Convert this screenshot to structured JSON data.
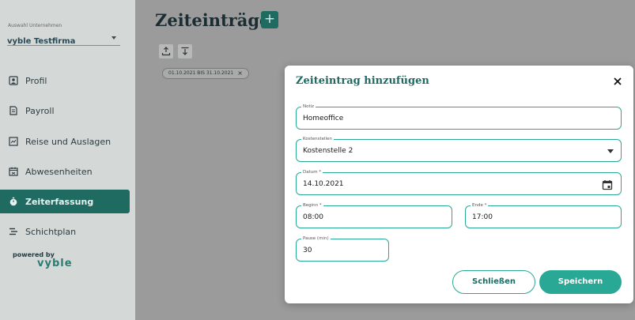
{
  "sidebar": {
    "company_caption": "Auswahl Unternehmen",
    "company_name": "vyble Testfirma",
    "items": [
      {
        "label": "Profil",
        "icon": "person-badge-icon"
      },
      {
        "label": "Payroll",
        "icon": "document-icon"
      },
      {
        "label": "Reise und Auslagen",
        "icon": "receipt-chart-icon"
      },
      {
        "label": "Abwesenheiten",
        "icon": "calendar-icon"
      },
      {
        "label": "Zeiterfassung",
        "icon": "stopwatch-icon",
        "active": true
      },
      {
        "label": "Schichtplan",
        "icon": "schedule-icon"
      }
    ],
    "powered_by": "powered by",
    "logo_text": "vyble"
  },
  "main": {
    "title": "Zeiteinträge",
    "add_label": "+",
    "filter_chip": "01.10.2021 BIS 31.10.2021",
    "chip_close": "×"
  },
  "modal": {
    "title": "Zeiteintrag hinzufügen",
    "close_label": "✕",
    "notiz": {
      "label": "Notiz",
      "value": "Homeoffice"
    },
    "kostenstellen": {
      "label": "Kostenstellen",
      "value": "Kostenstelle 2"
    },
    "datum": {
      "label": "Datum *",
      "value": "14.10.2021"
    },
    "beginn": {
      "label": "Beginn *",
      "value": "08:00"
    },
    "ende": {
      "label": "Ende *",
      "value": "17:00"
    },
    "pause": {
      "label": "Pause (min)",
      "value": "30"
    },
    "cancel_label": "Schließen",
    "save_label": "Speichern"
  },
  "colors": {
    "accent": "#2aa896",
    "dark_teal": "#1f6a61",
    "overlay": "#9b9b9b"
  }
}
